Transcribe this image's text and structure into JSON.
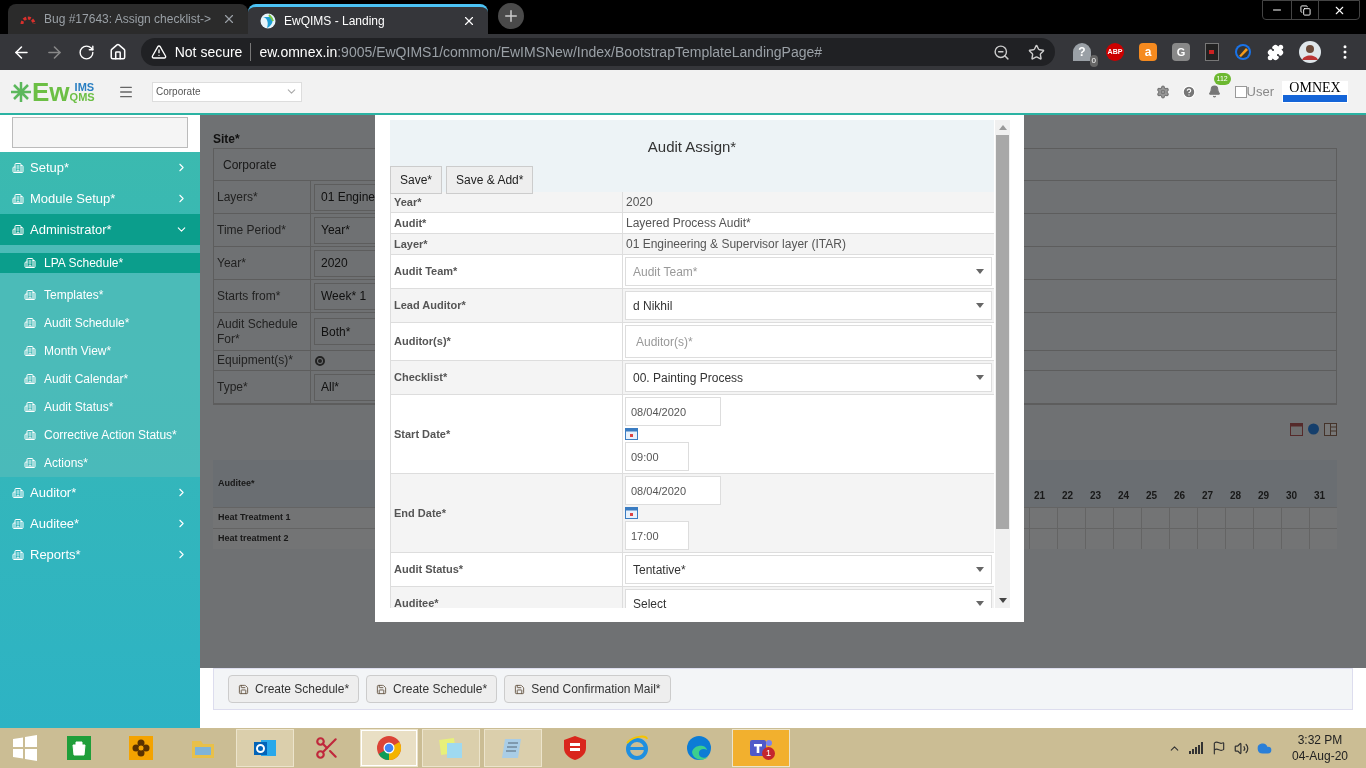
{
  "browser": {
    "tabs": [
      {
        "title": "Bug #17643: Assign checklist->",
        "selected": false
      },
      {
        "title": "EwQIMS - Landing",
        "selected": true
      }
    ],
    "address": {
      "security": "Not secure",
      "host": "ew.omnex.in",
      "path": ":9005/EwQIMS1/common/EwIMSNew/Index/BootstrapTemplateLandingPage#"
    },
    "extensions": [
      {
        "label": "?",
        "badge": "0"
      },
      {
        "label": "ABP"
      },
      {
        "label": "a"
      },
      {
        "label": "G"
      }
    ]
  },
  "header": {
    "logo": {
      "main": "Ew",
      "top": "IMS",
      "bottom": "QMS"
    },
    "site": "Corporate",
    "notifications": "112",
    "user": {
      "label": "User",
      "checked": false
    },
    "brand": "OMNEX"
  },
  "sidebar": {
    "items": [
      {
        "label": "Setup*",
        "expanded": false
      },
      {
        "label": "Module Setup*",
        "expanded": false
      },
      {
        "label": "Administrator*",
        "expanded": true,
        "children": [
          {
            "label": "LPA Schedule*",
            "selected": true
          },
          {
            "label": "Templates*",
            "selected": false
          },
          {
            "label": "Audit Schedule*",
            "selected": false
          },
          {
            "label": "Month View*",
            "selected": false
          },
          {
            "label": "Audit Calendar*",
            "selected": false
          },
          {
            "label": "Audit Status*",
            "selected": false
          },
          {
            "label": "Corrective Action Status*",
            "selected": false
          },
          {
            "label": "Actions*",
            "selected": false
          }
        ]
      },
      {
        "label": "Auditor*",
        "expanded": false
      },
      {
        "label": "Auditee*",
        "expanded": false
      },
      {
        "label": "Reports*",
        "expanded": false
      }
    ]
  },
  "page": {
    "site": {
      "label": "Site*",
      "value": "Corporate"
    },
    "fields": [
      {
        "label": "Layers*",
        "kind": "select",
        "value": "01 Engine"
      },
      {
        "label": "Time Period*",
        "kind": "select",
        "value": "Year*"
      },
      {
        "label": "Year*",
        "kind": "select",
        "value": "2020"
      },
      {
        "label": "Starts from*",
        "kind": "select",
        "value": "Week* 1"
      },
      {
        "label": "Audit Schedule For*",
        "kind": "select",
        "value": "Both*"
      },
      {
        "label": "Equipment(s)*",
        "kind": "radio",
        "checked": true
      },
      {
        "label": "Type*",
        "kind": "select",
        "value": "All*"
      }
    ],
    "schedule": {
      "header": "Auditee*",
      "days": [
        "21",
        "22",
        "23",
        "24",
        "25",
        "26",
        "27",
        "28",
        "29",
        "30",
        "31"
      ],
      "rows": [
        "Heat Treatment 1",
        "Heat treatment 2"
      ]
    },
    "buttons": [
      "Create Schedule*",
      "Create Schedule*",
      "Send Confirmation Mail*"
    ]
  },
  "modal": {
    "title": "Audit Assign*",
    "buttons": [
      "Save*",
      "Save & Add*"
    ],
    "rows": [
      {
        "label": "Year*",
        "kind": "text",
        "value": "2020"
      },
      {
        "label": "Audit*",
        "kind": "text",
        "value": "Layered Process Audit*"
      },
      {
        "label": "Layer*",
        "kind": "text",
        "value": "01 Engineering & Supervisor layer (ITAR)"
      },
      {
        "label": "Audit Team*",
        "kind": "select",
        "placeholder": "Audit Team*"
      },
      {
        "label": "Lead Auditor*",
        "kind": "select",
        "value": "d Nikhil"
      },
      {
        "label": "Auditor(s)*",
        "kind": "input",
        "placeholder": "Auditor(s)*"
      },
      {
        "label": "Checklist*",
        "kind": "select",
        "value": "00. Painting Process"
      },
      {
        "label": "Start Date*",
        "kind": "datetime",
        "date": "08/04/2020",
        "time": "09:00"
      },
      {
        "label": "End Date*",
        "kind": "datetime",
        "date": "08/04/2020",
        "time": "17:00"
      },
      {
        "label": "Audit Status*",
        "kind": "select",
        "value": "Tentative*"
      },
      {
        "label": "Auditee*",
        "kind": "select",
        "value": "Select"
      }
    ]
  },
  "taskbar": {
    "apps": [
      {
        "open": false,
        "selected": false,
        "flashing": false
      },
      {
        "open": false,
        "selected": false,
        "flashing": false
      },
      {
        "open": false,
        "selected": false,
        "flashing": false
      },
      {
        "open": true,
        "selected": false,
        "flashing": false
      },
      {
        "open": false,
        "selected": false,
        "flashing": false
      },
      {
        "open": true,
        "selected": true,
        "flashing": false
      },
      {
        "open": true,
        "selected": false,
        "flashing": false
      },
      {
        "open": true,
        "selected": false,
        "flashing": false
      },
      {
        "open": false,
        "selected": false,
        "flashing": false
      },
      {
        "open": false,
        "selected": false,
        "flashing": false
      },
      {
        "open": false,
        "selected": false,
        "flashing": false
      },
      {
        "open": true,
        "selected": false,
        "flashing": true,
        "badge": "1"
      }
    ],
    "clock": {
      "time": "3:32 PM",
      "date": "04-Aug-20"
    }
  }
}
